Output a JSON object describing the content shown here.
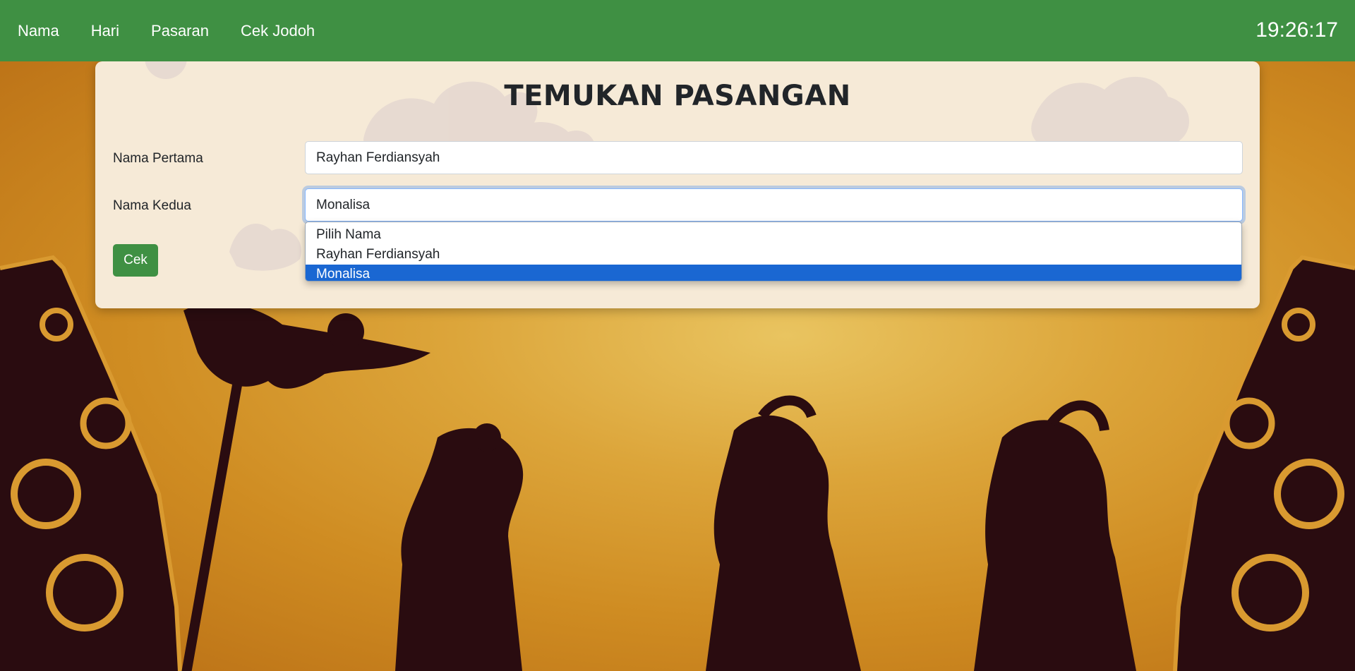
{
  "nav": {
    "items": [
      {
        "label": "Nama"
      },
      {
        "label": "Hari"
      },
      {
        "label": "Pasaran"
      },
      {
        "label": "Cek Jodoh"
      }
    ],
    "clock": "19:26:17"
  },
  "form": {
    "title": "TEMUKAN PASANGAN",
    "first_label": "Nama Pertama",
    "first_value": "Rayhan Ferdiansyah",
    "second_label": "Nama Kedua",
    "second_value": "Monalisa",
    "submit_label": "Cek"
  },
  "dropdown": {
    "options": [
      {
        "label": "Pilih Nama",
        "selected": false
      },
      {
        "label": "Rayhan Ferdiansyah",
        "selected": false
      },
      {
        "label": "Monalisa",
        "selected": true
      }
    ]
  },
  "colors": {
    "navbar": "#3f9043",
    "button": "#3f9043",
    "selected_option": "#1a67d2",
    "silhouette": "#2a0c10",
    "background_center": "#e9c460",
    "background_edge": "#b86d15"
  },
  "icons": {
    "background": "wayang-shadow-puppets-illustration",
    "card_decor": "mega-mendung-cloud-pattern"
  }
}
